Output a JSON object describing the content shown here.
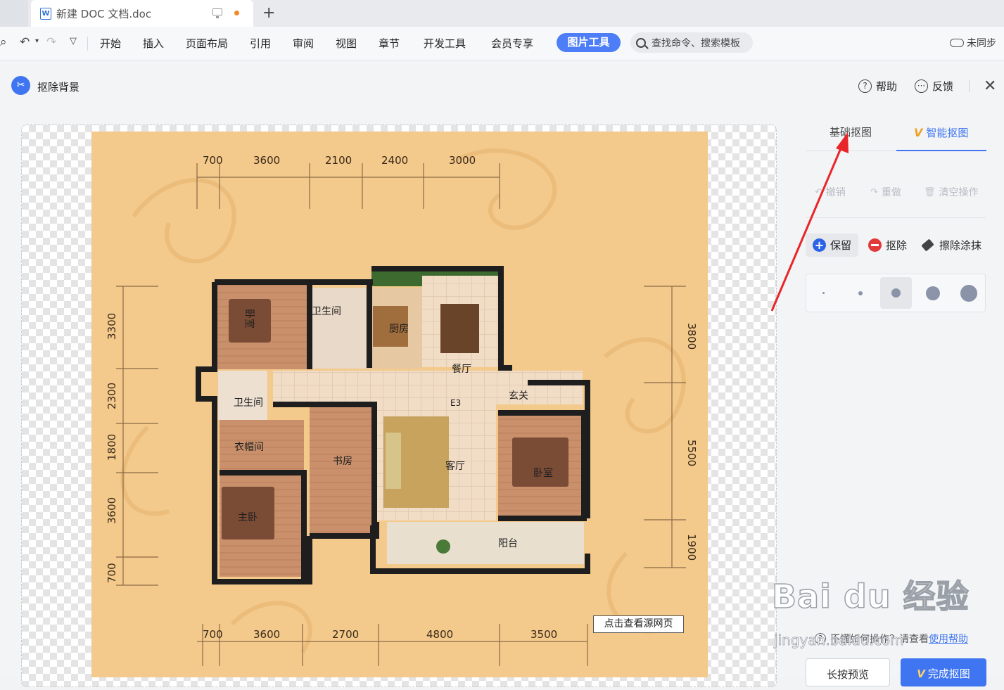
{
  "tabbar": {
    "doc_title": "新建 DOC 文档.doc",
    "add_label": "+"
  },
  "menubar": {
    "items": [
      "开始",
      "插入",
      "页面布局",
      "引用",
      "审阅",
      "视图",
      "章节",
      "开发工具",
      "会员专享"
    ],
    "active": "图片工具",
    "search_label": "查找命令、搜索模板",
    "sync_label": "未同步"
  },
  "panel": {
    "title": "抠除背景",
    "help_label": "帮助",
    "feedback_label": "反馈",
    "tabs": {
      "basic": "基础抠图",
      "smart": "智能抠图"
    },
    "ops": {
      "undo": "撤销",
      "redo": "重做",
      "clear": "清空操作"
    },
    "tools": {
      "keep": "保留",
      "remove": "抠除",
      "erase": "擦除涂抹"
    },
    "help_text": "不懂如何操作？请查看",
    "help_link": "使用帮助",
    "preview_button": "长按预览",
    "done_button": "完成抠图",
    "source_button": "点击查看源网页"
  },
  "floorplan": {
    "top_dims": [
      "700",
      "3600",
      "2100",
      "2400",
      "3000"
    ],
    "bottom_dims": [
      "700",
      "3600",
      "2700",
      "4800",
      "3500"
    ],
    "left_dims": [
      "3300",
      "2300",
      "1800",
      "3600",
      "700"
    ],
    "right_dims": [
      "3800",
      "5500",
      "1900"
    ],
    "rooms": {
      "bedroom_nw": "卧室",
      "bath_top": "卫生间",
      "kitchen": "厨房",
      "dining": "餐厅",
      "bath_left": "卫生间",
      "entry": "玄关",
      "e3": "E3",
      "closet": "衣帽间",
      "study": "书房",
      "living": "客厅",
      "bedroom_e": "卧室",
      "master": "主卧",
      "balcony": "阳台"
    }
  },
  "watermark": {
    "main": "Bai du 经验",
    "sub": "jingyan.baidu.com"
  },
  "colors": {
    "accent": "#3f75f0",
    "plan_bg": "#f3c98c",
    "wall": "#1e1e1e",
    "arrow": "#e8262a"
  }
}
